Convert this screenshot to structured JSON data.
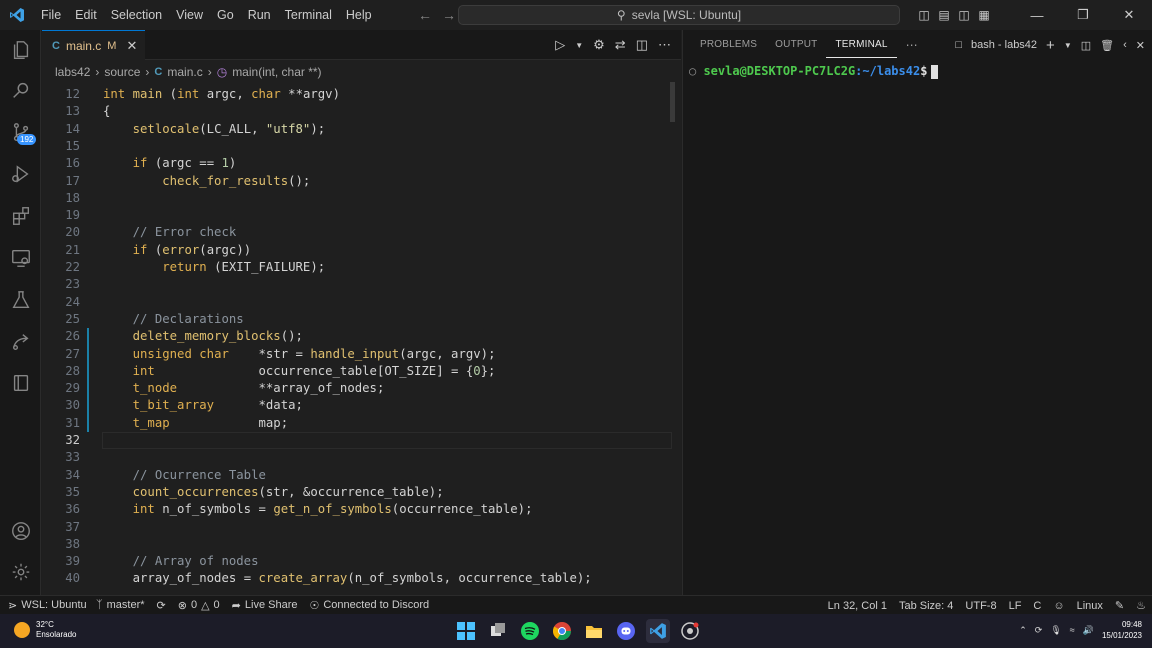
{
  "titlebar": {
    "menus": [
      "File",
      "Edit",
      "Selection",
      "View",
      "Go",
      "Run",
      "Terminal",
      "Help"
    ],
    "command_center": "sevla [WSL: Ubuntu]"
  },
  "activity": {
    "scm_badge": "192"
  },
  "editor": {
    "tab": {
      "icon_letter": "C",
      "name": "main.c",
      "status": "M"
    },
    "breadcrumb": {
      "root": "labs42",
      "folder": "source",
      "file_letter": "C",
      "file": "main.c",
      "symbol": "main(int, char **)"
    },
    "lines": [
      {
        "n": "12",
        "t": "int main (int argc, char **argv)"
      },
      {
        "n": "13",
        "t": "{"
      },
      {
        "n": "14",
        "t": "    setlocale(LC_ALL, \"utf8\");"
      },
      {
        "n": "15",
        "t": ""
      },
      {
        "n": "16",
        "t": "    if (argc == 1)"
      },
      {
        "n": "17",
        "t": "        check_for_results();"
      },
      {
        "n": "18",
        "t": ""
      },
      {
        "n": "19",
        "t": ""
      },
      {
        "n": "20",
        "t": "    // Error check"
      },
      {
        "n": "21",
        "t": "    if (error(argc))"
      },
      {
        "n": "22",
        "t": "        return (EXIT_FAILURE);"
      },
      {
        "n": "23",
        "t": ""
      },
      {
        "n": "24",
        "t": ""
      },
      {
        "n": "25",
        "t": "    // Declarations"
      },
      {
        "n": "26",
        "t": "    delete_memory_blocks();"
      },
      {
        "n": "27",
        "t": "    unsigned char    *str = handle_input(argc, argv);"
      },
      {
        "n": "28",
        "t": "    int              occurrence_table[OT_SIZE] = {0};"
      },
      {
        "n": "29",
        "t": "    t_node           **array_of_nodes;"
      },
      {
        "n": "30",
        "t": "    t_bit_array      *data;"
      },
      {
        "n": "31",
        "t": "    t_map            map;"
      },
      {
        "n": "32",
        "t": ""
      },
      {
        "n": "33",
        "t": ""
      },
      {
        "n": "34",
        "t": "    // Ocurrence Table"
      },
      {
        "n": "35",
        "t": "    count_occurrences(str, &occurrence_table);"
      },
      {
        "n": "36",
        "t": "    int n_of_symbols = get_n_of_symbols(occurrence_table);"
      },
      {
        "n": "37",
        "t": ""
      },
      {
        "n": "38",
        "t": ""
      },
      {
        "n": "39",
        "t": "    // Array of nodes"
      },
      {
        "n": "40",
        "t": "    array_of_nodes = create_array(n_of_symbols, occurrence_table);"
      }
    ],
    "current_line": "32"
  },
  "panel": {
    "tabs": [
      "PROBLEMS",
      "OUTPUT",
      "TERMINAL"
    ],
    "active_tab": "TERMINAL",
    "terminal_name": "bash - labs42",
    "prompt_user": "sevla@DESKTOP-PC7LC2G",
    "prompt_path": ":~/labs42",
    "prompt_symbol": "$"
  },
  "status": {
    "remote": "WSL: Ubuntu",
    "branch": "master*",
    "errors": "0",
    "warnings": "0",
    "live_share": "Live Share",
    "discord": "Connected to Discord",
    "position": "Ln 32, Col 1",
    "tab_size": "Tab Size: 4",
    "encoding": "UTF-8",
    "eol": "LF",
    "language": "C",
    "os": "Linux"
  },
  "taskbar": {
    "temperature": "32°C",
    "weather": "Ensolarado",
    "time": "09:48",
    "date": "15/01/2023"
  },
  "colors": {
    "accent": "#0078d4",
    "badge": "#3794ff",
    "git_modified": "#e2c08d"
  }
}
